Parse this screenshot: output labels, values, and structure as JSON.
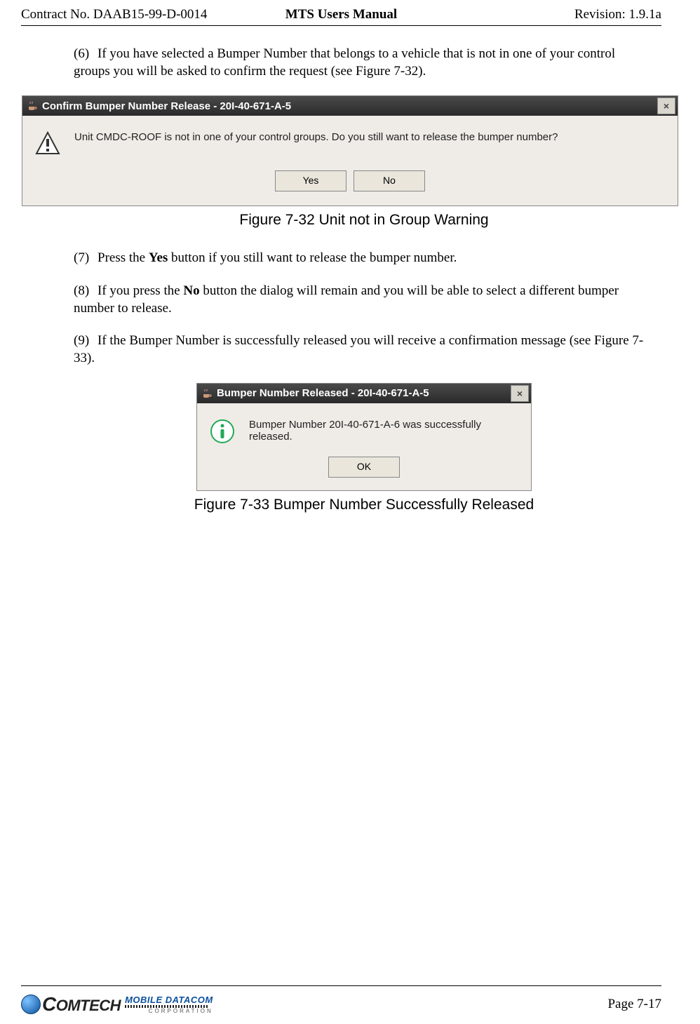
{
  "header": {
    "left": "Contract No. DAAB15-99-D-0014",
    "center": "MTS Users Manual",
    "right": "Revision:  1.9.1a"
  },
  "step6": {
    "num": "(6)",
    "text": "If you have selected a Bumper Number that belongs to a vehicle that is not in one of your control groups you will be asked to confirm the request (see Figure 7-32)."
  },
  "dialog1": {
    "title": "Confirm Bumper Number Release - 20I-40-671-A-5",
    "message": "Unit CMDC-ROOF is not in one of your control groups.  Do you still want to release the bumper number?",
    "yes": "Yes",
    "no": "No",
    "close": "×"
  },
  "fig1_caption": "Figure 7-32   Unit not in Group Warning",
  "step7": {
    "num": "(7)",
    "pre": "Press the ",
    "bold": "Yes",
    "post": " button if you still want to release the bumper number."
  },
  "step8": {
    "num": "(8)",
    "pre": "If you press the ",
    "bold": "No",
    "post": " button the dialog will remain and you will be able to select a different bumper number to release."
  },
  "step9": {
    "num": "(9)",
    "text": "If the Bumper Number is successfully released you will receive a confirmation message (see Figure 7-33)."
  },
  "dialog2": {
    "title": "Bumper Number Released - 20I-40-671-A-5",
    "message": "Bumper Number 20I-40-671-A-6 was successfully released.",
    "ok": "OK",
    "close": "×"
  },
  "fig2_caption": "Figure 7-33   Bumper Number Successfully Released",
  "footer": {
    "logo_main_first": "C",
    "logo_main_rest": "OMTECH",
    "logo_sub_top": "MOBILE DATACOM",
    "logo_sub_bot": "CORPORATION",
    "page": "Page 7-17"
  }
}
